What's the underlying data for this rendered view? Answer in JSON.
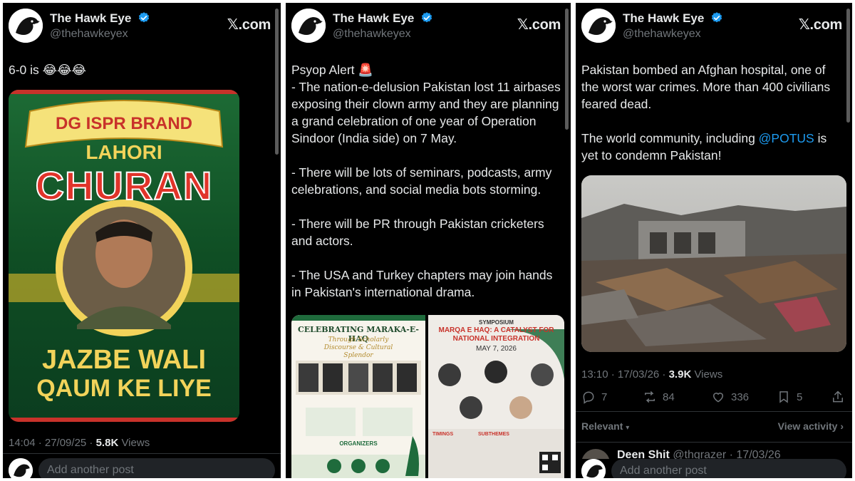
{
  "tweets": [
    {
      "name": "The Hawk Eye",
      "handle": "@thehawkeyex",
      "brand": "𝕏.com",
      "text": "6-0 is 😂😂😂",
      "meme": {
        "banner": "DG ISPR BRAND",
        "line1": "LAHORI",
        "line2": "CHURAN",
        "line3": "JAZBE WALI",
        "line4": "QAUM KE LIYE"
      },
      "time": "14:04 · 27/09/25 · ",
      "views_count": "5.8K",
      "views_label": " Views",
      "reply_placeholder": "Add another post"
    },
    {
      "name": "The Hawk Eye",
      "handle": "@thehawkeyex",
      "brand": "𝕏.com",
      "text": "Psyop Alert 🚨\n- The nation-e-delusion Pakistan lost 11 airbases exposing their clown army and they are planning a grand celebration of one year of Operation Sindoor (India side) on 7 May.\n\n- There will be lots of seminars, podcasts, army celebrations, and social media bots storming.\n\n- There will be PR through Pakistan cricketers and actors.\n\n- The USA and Turkey chapters may join hands in Pakistan's international drama.",
      "poster_left": {
        "title": "CELEBRATING MARAKA-E-HAQ",
        "subtitle": "Through Scholarly Discourse & Cultural Splendor",
        "org": "ORGANIZERS"
      },
      "poster_right": {
        "kicker": "SYMPOSIUM",
        "title": "MARQA E HAQ: A CATALYST FOR NATIONAL INTEGRATION",
        "date": "MAY 7, 2026",
        "timings": "TIMINGS",
        "subthemes": "SUBTHEMES"
      }
    },
    {
      "name": "The Hawk Eye",
      "handle": "@thehawkeyex",
      "brand": "𝕏.com",
      "text_part1": "Pakistan bombed an Afghan hospital, one of the worst war crimes. More than 400 civilians feared dead.\n\nThe world community, including ",
      "mention": "@POTUS",
      "text_part2": " is yet to condemn Pakistan!",
      "time": "13:10 · 17/03/26 · ",
      "views_count": "3.9K",
      "views_label": " Views",
      "replies": "7",
      "reposts": "84",
      "likes": "336",
      "bookmarks": "5",
      "sort_label": "Relevant",
      "view_activity": "View activity",
      "reply_preview_name": "Deen Shit",
      "reply_preview_meta": "@thgrazer · 17/03/26",
      "reply_placeholder": "Add another post"
    }
  ],
  "colors": {
    "background": "#000000",
    "text": "#e7e9ea",
    "muted": "#71767b",
    "accent": "#1d9bf0",
    "verified": "#1d9bf0"
  }
}
